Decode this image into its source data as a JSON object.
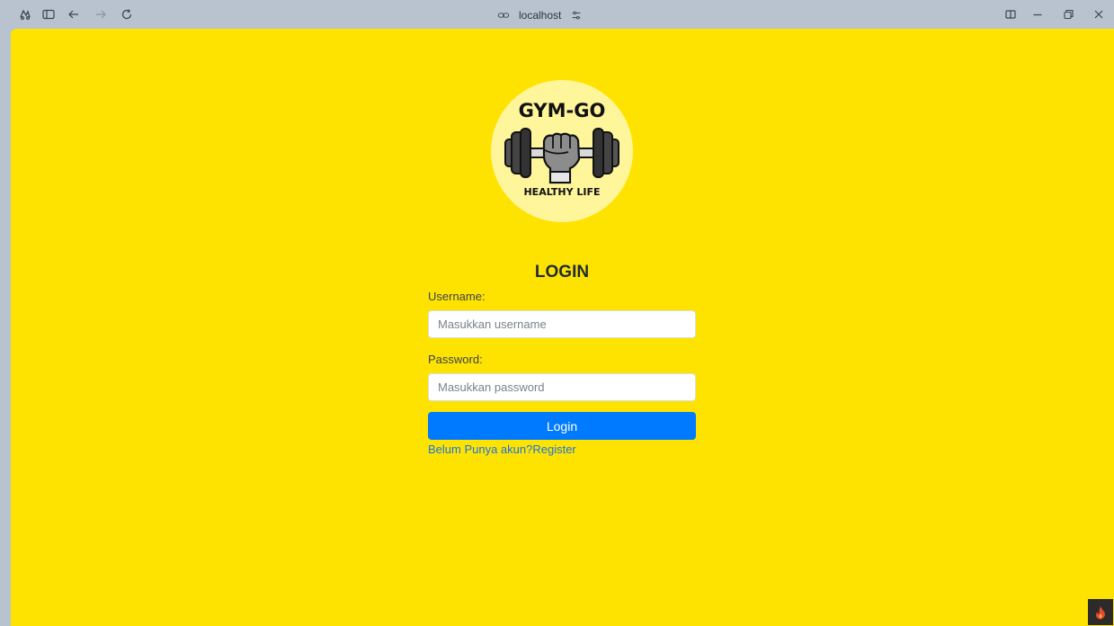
{
  "browser": {
    "address": "localhost",
    "icons": [
      "extensions-icon",
      "sidebar-icon",
      "back-icon",
      "forward-icon",
      "reload-icon",
      "link-icon",
      "site-settings-icon",
      "split-view-icon",
      "minimize-icon",
      "restore-icon",
      "close-icon"
    ]
  },
  "logo": {
    "top_text": "GYM-GO",
    "bottom_text": "HEALTHY LIFE"
  },
  "form": {
    "title": "LOGIN",
    "username_label": "Username:",
    "username_placeholder": "Masukkan username",
    "username_value": "",
    "password_label": "Password:",
    "password_placeholder": "Masukkan password",
    "password_value": "",
    "login_button": "Login",
    "register_link": "Belum Punya akun?Register"
  },
  "colors": {
    "page_background": "#ffe300",
    "logo_background": "#fff59b",
    "button": "#007bff",
    "link": "#1a73e8",
    "browser_chrome": "#b9c3cf"
  }
}
